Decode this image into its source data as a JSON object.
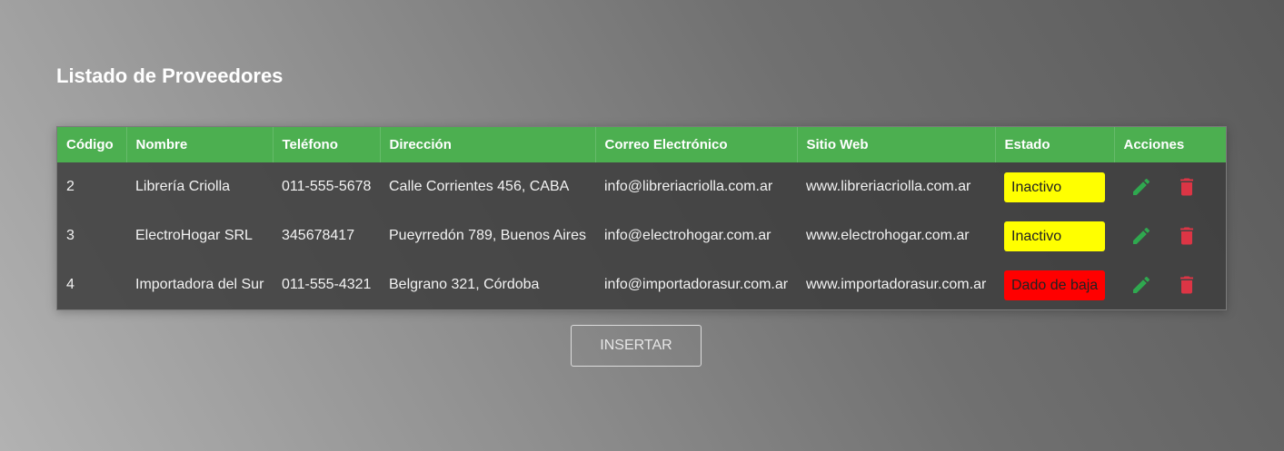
{
  "page": {
    "title": "Listado de Proveedores"
  },
  "table": {
    "headers": [
      "Código",
      "Nombre",
      "Teléfono",
      "Dirección",
      "Correo Electrónico",
      "Sitio Web",
      "Estado",
      "Acciones"
    ],
    "rows": [
      {
        "codigo": "2",
        "nombre": "Librería Criolla",
        "telefono": "011-555-5678",
        "direccion": "Calle Corrientes 456, CABA",
        "correo": "info@libreriacriolla.com.ar",
        "web": "www.libreriacriolla.com.ar",
        "estado": "Inactivo",
        "estado_color": "#ffff00"
      },
      {
        "codigo": "3",
        "nombre": "ElectroHogar SRL",
        "telefono": "345678417",
        "direccion": "Pueyrredón 789, Buenos Aires",
        "correo": "info@electrohogar.com.ar",
        "web": "www.electrohogar.com.ar",
        "estado": "Inactivo",
        "estado_color": "#ffff00"
      },
      {
        "codigo": "4",
        "nombre": "Importadora del Sur",
        "telefono": "011-555-4321",
        "direccion": "Belgrano 321, Córdoba",
        "correo": "info@importadorasur.com.ar",
        "web": "www.importadorasur.com.ar",
        "estado": "Dado de baja",
        "estado_color": "#ff0000"
      }
    ],
    "icons": {
      "edit": "pencil-icon",
      "delete": "trash-icon"
    }
  },
  "colors": {
    "header": "#4caf50",
    "edit_icon": "#2fa84f",
    "delete_icon": "#dc3545"
  },
  "actions": {
    "insert_label": "INSERTAR"
  }
}
